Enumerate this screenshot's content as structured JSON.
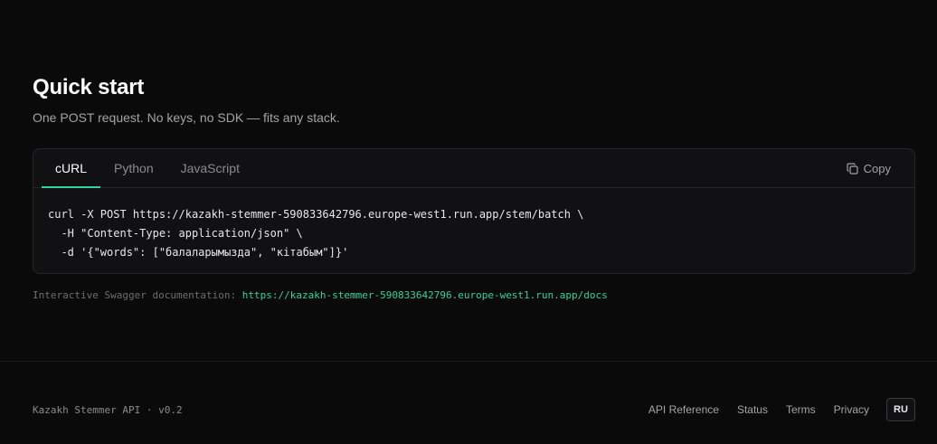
{
  "quickstart": {
    "title": "Quick start",
    "subtitle": "One POST request. No keys, no SDK — fits any stack."
  },
  "code_card": {
    "tabs": [
      {
        "label": "cURL",
        "active": true
      },
      {
        "label": "Python",
        "active": false
      },
      {
        "label": "JavaScript",
        "active": false
      }
    ],
    "copy_label": "Copy",
    "copy_icon": "copy-icon",
    "code_lines": [
      "curl -X POST https://kazakh-stemmer-590833642796.europe-west1.run.app/stem/batch \\",
      "  -H \"Content-Type: application/json\" \\",
      "  -d '{\"words\": [\"балаларымызда\", \"кітабым\"]}'"
    ]
  },
  "swagger": {
    "label": "Interactive Swagger documentation:",
    "url": "https://kazakh-stemmer-590833642796.europe-west1.run.app/docs"
  },
  "footer": {
    "left_text": "Kazakh Stemmer API · v0.2",
    "links": [
      "API Reference",
      "Status",
      "Terms",
      "Privacy"
    ],
    "lang": "RU"
  },
  "colors": {
    "background": "#0a0a0b",
    "accent": "#34d399"
  }
}
